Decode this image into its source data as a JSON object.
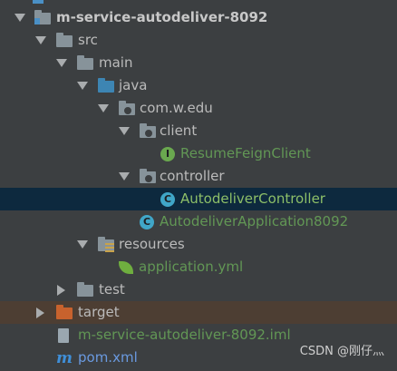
{
  "tree": {
    "module_name": "m-service-autodeliver-8092",
    "src": "src",
    "main": "main",
    "java": "java",
    "package": "com.w.edu",
    "client": "client",
    "resume_feign_client": "ResumeFeignClient",
    "controller": "controller",
    "autodeliver_controller": "AutodeliverController",
    "autodeliver_application": "AutodeliverApplication8092",
    "resources": "resources",
    "application_yml": "application.yml",
    "test": "test",
    "target": "target",
    "iml_file": "m-service-autodeliver-8092.iml",
    "pom_file": "pom.xml"
  },
  "icons": {
    "interface": "I",
    "class": "C",
    "maven": "m"
  },
  "watermark": "CSDN @刚仔灬",
  "colors": {
    "background": "#3c3f41",
    "selected_row": "#0d293e",
    "excluded_row": "#4d3e33",
    "file_green": "#629755",
    "file_blue": "#6a9ae0"
  }
}
